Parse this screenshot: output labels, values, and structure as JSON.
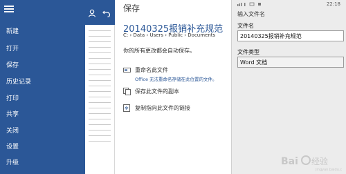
{
  "nav": {
    "items": [
      "新建",
      "打开",
      "保存",
      "历史记录",
      "打印",
      "共享",
      "关闭",
      "设置",
      "升级"
    ]
  },
  "preview": {
    "icons": [
      "user-icon",
      "back-icon"
    ]
  },
  "save": {
    "title": "保存",
    "filename": "20140325报销补充规范",
    "path": "C: › Data › Users › Public › Documents",
    "autosave": "你的所有更改都会自动保存。",
    "actions": [
      {
        "label": "重命名此文件",
        "warning": "Office 无法重命名存储在此位置的文件。",
        "icon": "rename-icon"
      },
      {
        "label": "保存此文件的副本",
        "icon": "copy-icon"
      },
      {
        "label": "复制指向此文件的链接",
        "icon": "link-icon"
      }
    ]
  },
  "dialog": {
    "time": "22:18",
    "heading": "输入文件名",
    "filename_label": "文件名",
    "filename_value": "20140325报销补充规范",
    "filetype_label": "文件类型",
    "filetype_value": "Word 文档"
  },
  "colors": {
    "accent": "#2b5797",
    "dialog_bg": "#ececec"
  }
}
